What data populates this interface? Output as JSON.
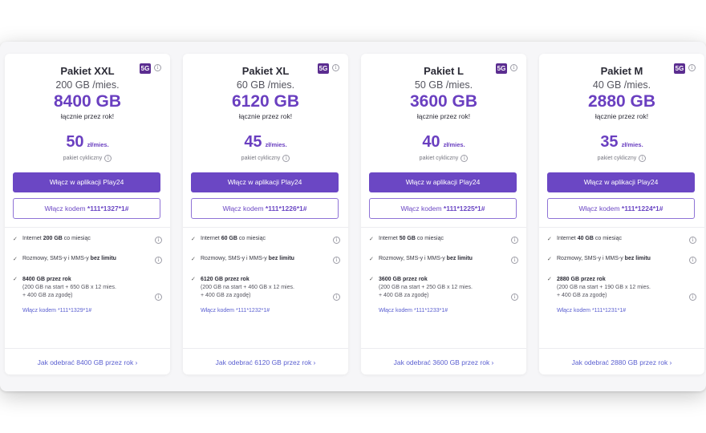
{
  "colors": {
    "accent": "#6a3fc0",
    "badge": "#5b2d90",
    "link": "#5a5fd0"
  },
  "badge_label": "5G",
  "common": {
    "total_label": "łącznie przez rok!",
    "price_unit": "zł/mies.",
    "cycle_label": "pakiet cykliczny",
    "app_button": "Włącz w aplikacji Play24",
    "code_prefix": "Włącz kodem",
    "f1_prefix": "Internet",
    "f1_suffix": "co miesiąc",
    "f2_text": "Rozmowy, SMS-y i MMS-y",
    "f2_bold": "bez limitu",
    "f3_suffix": "przez rok",
    "f3_note": "+ 400 GB za zgodę)",
    "foot_prefix": "Jak odebrać",
    "foot_suffix": "przez rok ›",
    "info_glyph": "i",
    "check_glyph": "✓"
  },
  "cards": [
    {
      "name": "Pakiet XXL",
      "data": "200 GB /mies.",
      "total": "8400 GB",
      "price": "50",
      "code": "*111*1327*1#",
      "f1_data": "200 GB",
      "f3_total": "8400 GB",
      "f3_line": "(200 GB na start + 650 GB x 12 mies.",
      "extra_code": "Włącz kodem *111*1329*1#",
      "foot": "8400 GB"
    },
    {
      "name": "Pakiet XL",
      "data": "60 GB /mies.",
      "total": "6120 GB",
      "price": "45",
      "code": "*111*1226*1#",
      "f1_data": "60 GB",
      "f3_total": "6120 GB",
      "f3_line": "(200 GB na start + 460 GB x 12 mies.",
      "extra_code": "Włącz kodem *111*1232*1#",
      "foot": "6120 GB"
    },
    {
      "name": "Pakiet L",
      "data": "50 GB /mies.",
      "total": "3600 GB",
      "price": "40",
      "code": "*111*1225*1#",
      "f1_data": "50 GB",
      "f3_total": "3600 GB",
      "f3_line": "(200 GB na start + 250 GB x 12 mies.",
      "extra_code": "Włącz kodem *111*1233*1#",
      "foot": "3600 GB"
    },
    {
      "name": "Pakiet M",
      "data": "40 GB /mies.",
      "total": "2880 GB",
      "price": "35",
      "code": "*111*1224*1#",
      "f1_data": "40 GB",
      "f3_total": "2880 GB",
      "f3_line": "(200 GB na start + 190 GB x 12 mies.",
      "extra_code": "Włącz kodem *111*1231*1#",
      "foot": "2880 GB"
    }
  ]
}
